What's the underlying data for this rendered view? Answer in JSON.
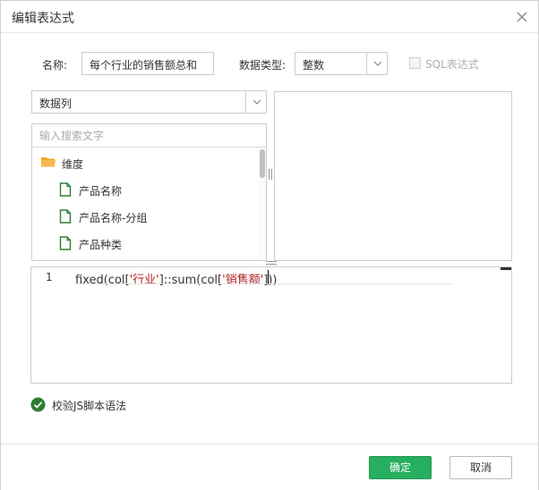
{
  "dialog": {
    "title": "编辑表达式",
    "close_icon": "close-icon"
  },
  "form": {
    "name_label": "名称:",
    "name_value": "每个行业的销售额总和",
    "type_label": "数据类型:",
    "type_value": "整数",
    "sql_label": "SQL表达式",
    "sql_checked": false,
    "sql_enabled": false
  },
  "field_panel": {
    "select_value": "数据列",
    "search_placeholder": "输入搜索文字",
    "folder": {
      "label": "维度",
      "icon": "folder-icon"
    },
    "items": [
      {
        "label": "产品名称",
        "icon": "file-icon"
      },
      {
        "label": "产品名称-分组",
        "icon": "file-icon"
      },
      {
        "label": "产品种类",
        "icon": "file-icon"
      }
    ]
  },
  "editor": {
    "line_number": "1",
    "code_parts": [
      "fixed(col[",
      "'行业'",
      "]::sum(col[",
      "'销售额'",
      "]))"
    ]
  },
  "validate": {
    "label": "校验JS脚本语法",
    "icon": "check-circle-icon"
  },
  "footer": {
    "ok_label": "确定",
    "cancel_label": "取消"
  },
  "colors": {
    "primary": "#27ae60",
    "folder": "#f5a623",
    "file": "#2e7d32",
    "string": "#b21d1d"
  }
}
